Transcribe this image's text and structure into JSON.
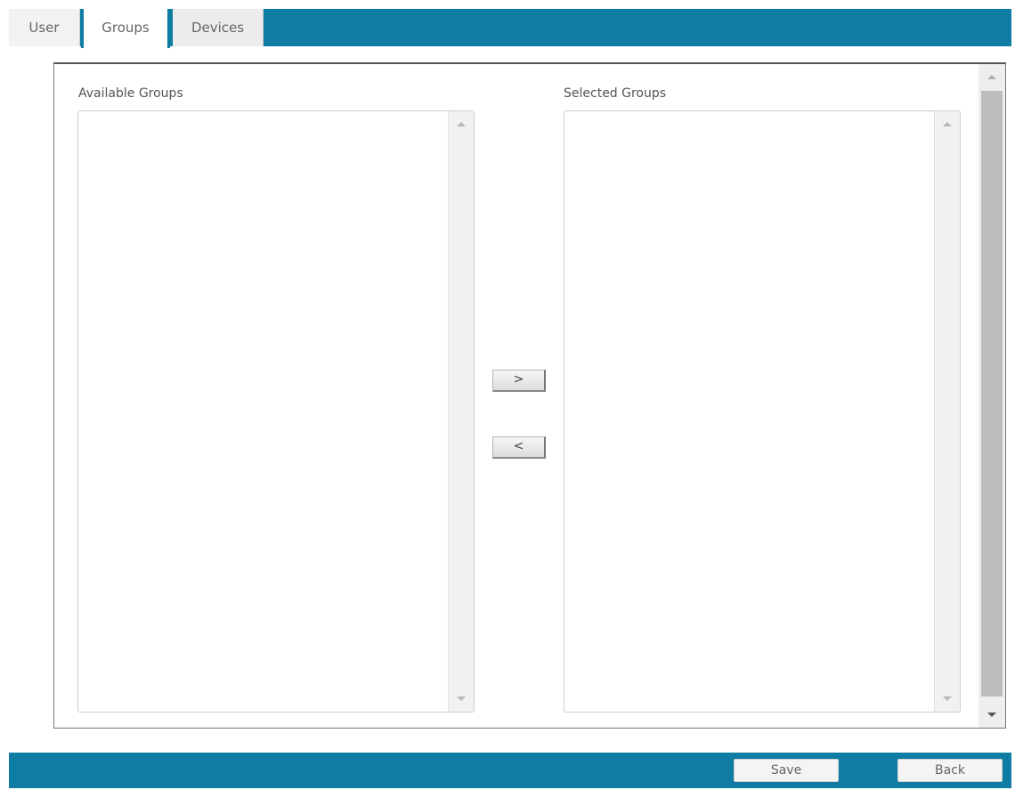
{
  "tabs": {
    "user": "User",
    "groups": "Groups",
    "devices": "Devices"
  },
  "panel": {
    "available_label": "Available Groups",
    "selected_label": "Selected Groups",
    "move_right": ">",
    "move_left": "<"
  },
  "footer": {
    "save": "Save",
    "back": "Back"
  },
  "colors": {
    "accent": "#0f7ca4"
  }
}
